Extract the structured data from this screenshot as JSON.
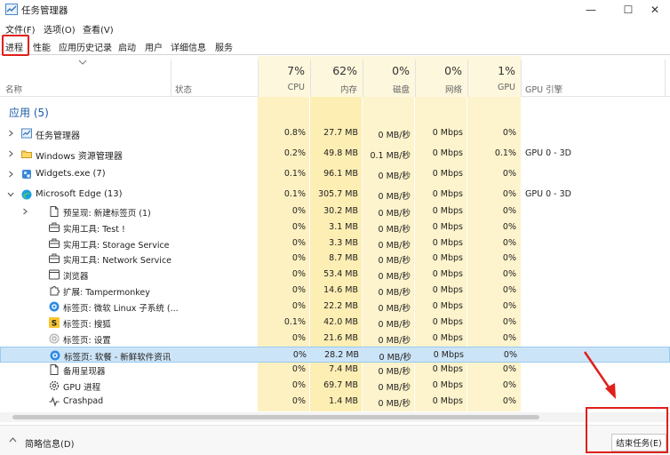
{
  "window": {
    "title": "任务管理器",
    "minimize": "—",
    "maximize": "☐",
    "close": "✕"
  },
  "menu": [
    "文件(F)",
    "选项(O)",
    "查看(V)"
  ],
  "tabs": [
    "进程",
    "性能",
    "应用历史记录",
    "启动",
    "用户",
    "详细信息",
    "服务"
  ],
  "columns": {
    "name": "名称",
    "status": "状态",
    "cpu": {
      "pct": "7%",
      "label": "CPU"
    },
    "memory": {
      "pct": "62%",
      "label": "内存"
    },
    "disk": {
      "pct": "0%",
      "label": "磁盘"
    },
    "network": {
      "pct": "0%",
      "label": "网络"
    },
    "gpu": {
      "pct": "1%",
      "label": "GPU"
    },
    "gpu_engine": {
      "label": "GPU 引擎"
    }
  },
  "group_header": "应用 (5)",
  "rows": [
    {
      "name": "任务管理器",
      "cpu": "0.8%",
      "mem": "27.7 MB",
      "disk": "0 MB/秒",
      "net": "0 Mbps",
      "gpu": "0%",
      "engine": "",
      "icon": "task-manager-icon",
      "level": 0
    },
    {
      "name": "Windows 资源管理器",
      "cpu": "0.2%",
      "mem": "49.8 MB",
      "disk": "0.1 MB/秒",
      "net": "0 Mbps",
      "gpu": "0.1%",
      "engine": "GPU 0 - 3D",
      "icon": "folder-icon",
      "level": 0
    },
    {
      "name": "Widgets.exe (7)",
      "cpu": "0.1%",
      "mem": "96.1 MB",
      "disk": "0 MB/秒",
      "net": "0 Mbps",
      "gpu": "0%",
      "engine": "",
      "icon": "widgets-icon",
      "level": 0
    },
    {
      "name": "Microsoft Edge (13)",
      "cpu": "0.1%",
      "mem": "305.7 MB",
      "disk": "0 MB/秒",
      "net": "0 Mbps",
      "gpu": "0%",
      "engine": "GPU 0 - 3D",
      "icon": "edge-icon",
      "level": 0
    },
    {
      "name": "预呈现: 新建标签页 (1)",
      "cpu": "0%",
      "mem": "30.2 MB",
      "disk": "0 MB/秒",
      "net": "0 Mbps",
      "gpu": "0%",
      "engine": "",
      "icon": "page-icon",
      "level": 1
    },
    {
      "name": "实用工具: Test !",
      "cpu": "0%",
      "mem": "3.1 MB",
      "disk": "0 MB/秒",
      "net": "0 Mbps",
      "gpu": "0%",
      "engine": "",
      "icon": "briefcase-icon",
      "level": 1
    },
    {
      "name": "实用工具: Storage Service",
      "cpu": "0%",
      "mem": "3.3 MB",
      "disk": "0 MB/秒",
      "net": "0 Mbps",
      "gpu": "0%",
      "engine": "",
      "icon": "briefcase-icon",
      "level": 1
    },
    {
      "name": "实用工具: Network Service",
      "cpu": "0%",
      "mem": "8.7 MB",
      "disk": "0 MB/秒",
      "net": "0 Mbps",
      "gpu": "0%",
      "engine": "",
      "icon": "briefcase-icon",
      "level": 1
    },
    {
      "name": "浏览器",
      "cpu": "0%",
      "mem": "53.4 MB",
      "disk": "0 MB/秒",
      "net": "0 Mbps",
      "gpu": "0%",
      "engine": "",
      "icon": "browser-icon",
      "level": 1
    },
    {
      "name": "扩展: Tampermonkey",
      "cpu": "0%",
      "mem": "14.6 MB",
      "disk": "0 MB/秒",
      "net": "0 Mbps",
      "gpu": "0%",
      "engine": "",
      "icon": "puzzle-icon",
      "level": 1
    },
    {
      "name": "标签页: 微软 Linux 子系统 (...",
      "cpu": "0%",
      "mem": "22.2 MB",
      "disk": "0 MB/秒",
      "net": "0 Mbps",
      "gpu": "0%",
      "engine": "",
      "icon": "blue-circle-icon",
      "level": 1
    },
    {
      "name": "标签页: 搜狐",
      "cpu": "0.1%",
      "mem": "42.0 MB",
      "disk": "0 MB/秒",
      "net": "0 Mbps",
      "gpu": "0%",
      "engine": "",
      "icon": "sohu-icon",
      "level": 1
    },
    {
      "name": "标签页: 设置",
      "cpu": "0%",
      "mem": "21.6 MB",
      "disk": "0 MB/秒",
      "net": "0 Mbps",
      "gpu": "0%",
      "engine": "",
      "icon": "settings-gear-icon",
      "level": 1
    },
    {
      "name": "标签页: 软餐 - 新鲜软件资讯",
      "cpu": "0%",
      "mem": "28.2 MB",
      "disk": "0 MB/秒",
      "net": "0 Mbps",
      "gpu": "0%",
      "engine": "",
      "icon": "blue-circle-icon",
      "level": 1,
      "selected": true
    },
    {
      "name": "备用呈现器",
      "cpu": "0%",
      "mem": "7.4 MB",
      "disk": "0 MB/秒",
      "net": "0 Mbps",
      "gpu": "0%",
      "engine": "",
      "icon": "page-icon",
      "level": 1
    },
    {
      "name": "GPU 进程",
      "cpu": "0%",
      "mem": "69.7 MB",
      "disk": "0 MB/秒",
      "net": "0 Mbps",
      "gpu": "0%",
      "engine": "",
      "icon": "gpu-gear-icon",
      "level": 1
    },
    {
      "name": "Crashpad",
      "cpu": "0%",
      "mem": "1.4 MB",
      "disk": "0 MB/秒",
      "net": "0 Mbps",
      "gpu": "0%",
      "engine": "",
      "icon": "pulse-icon",
      "level": 1
    }
  ],
  "footer": {
    "summary": "简略信息(D)",
    "end_task": "结束任务(E)"
  },
  "colors": {
    "heat_light": "#fff4c4",
    "heat_mid": "#ffe9a0",
    "heat_header": "#fdf6d8",
    "selection": "#cce4f7",
    "annotation": "#e0201b",
    "group_title": "#1a5aa6"
  }
}
